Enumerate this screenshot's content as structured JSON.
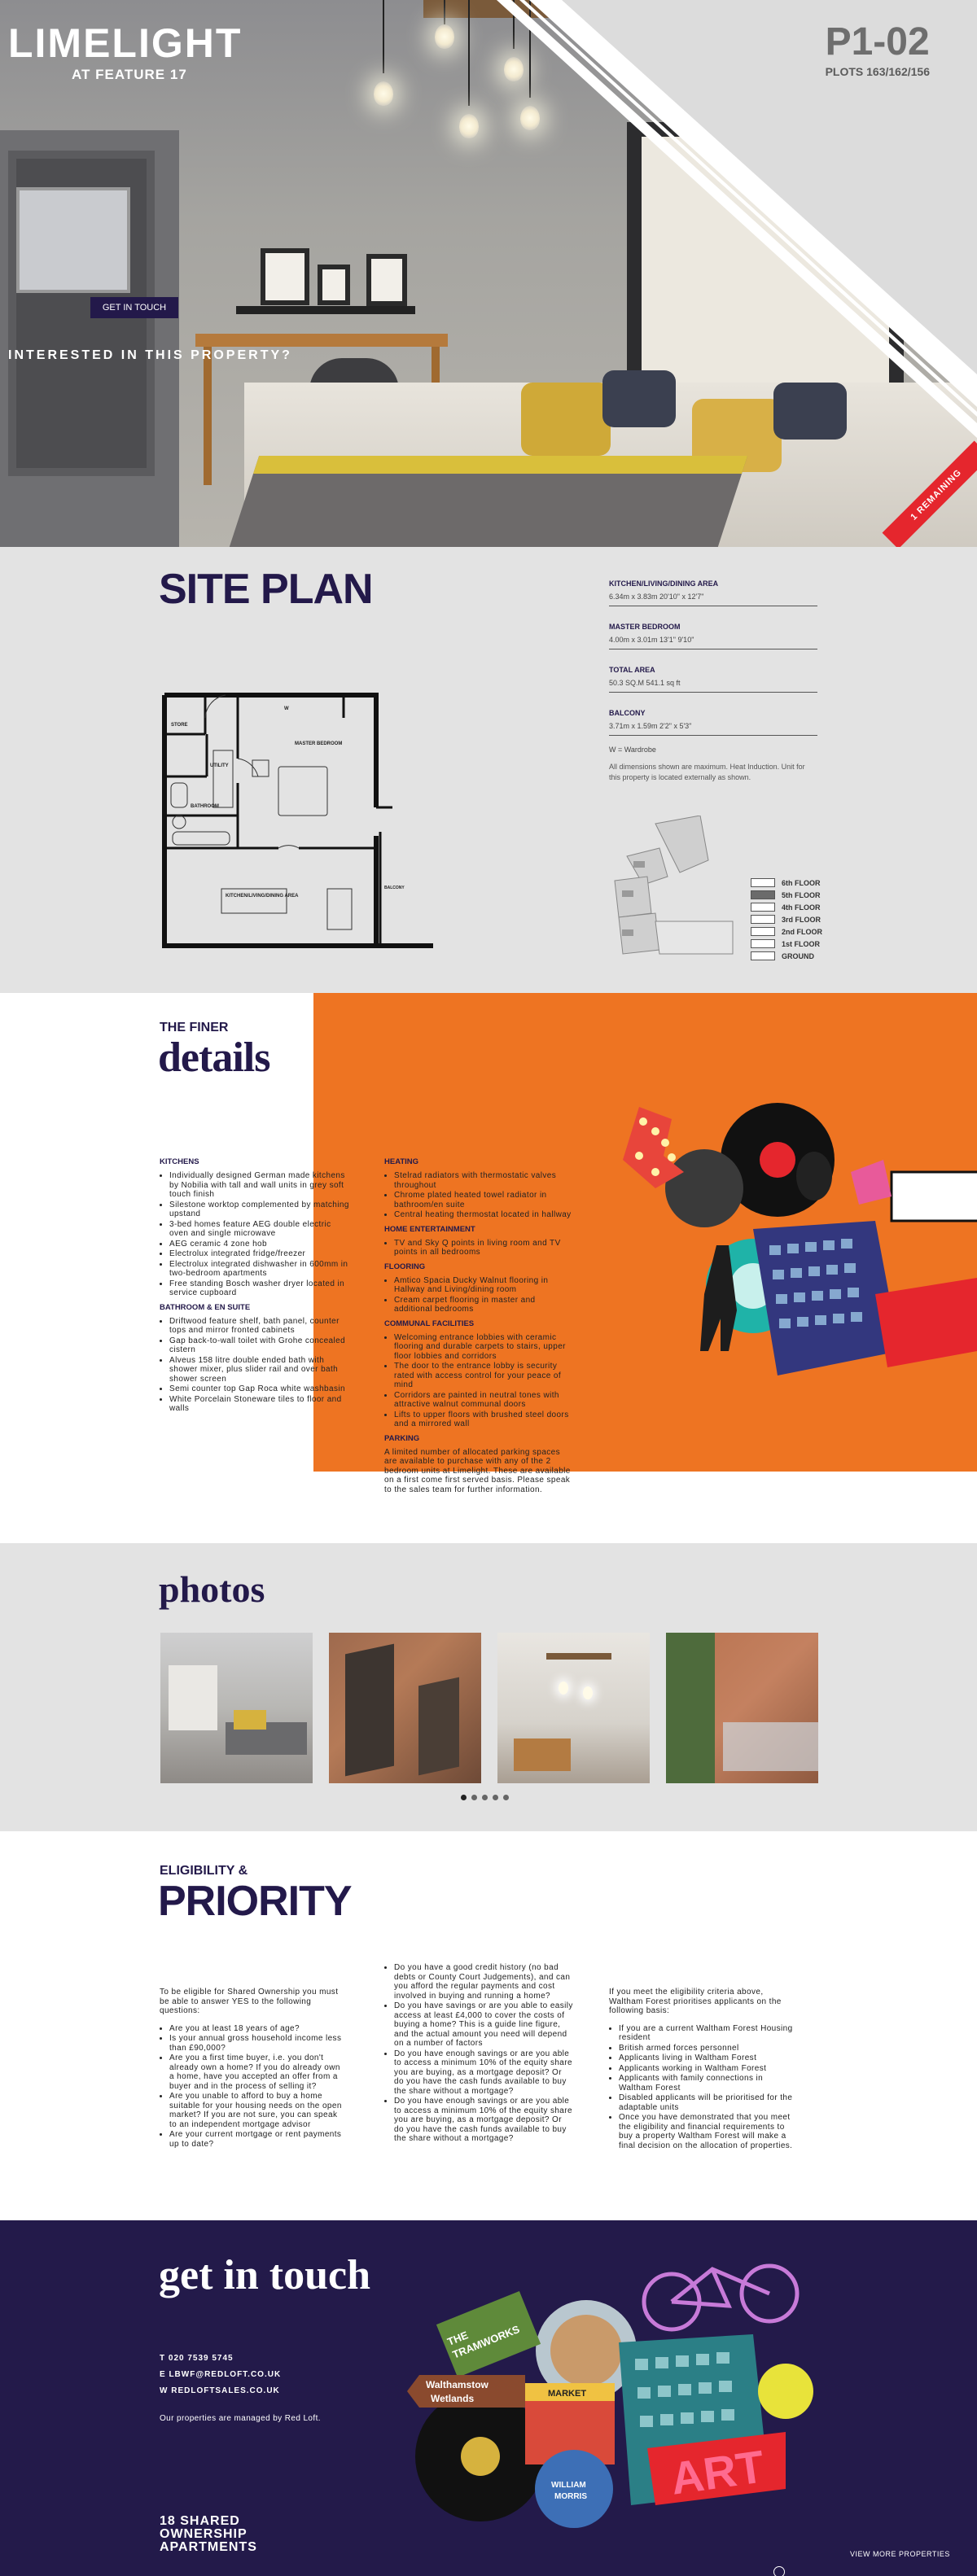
{
  "hero": {
    "logo_main": "LIMELIGHT",
    "logo_sub": "AT FEATURE 17",
    "plot_title": "P1-02",
    "plot_sub": "PLOTS 163/162/156",
    "cta_button": "GET IN TOUCH",
    "cta_text": "INTERESTED IN THIS PROPERTY?",
    "badge": "1 REMAINING"
  },
  "site_plan": {
    "title": "SITE PLAN",
    "specs": [
      {
        "label": "KITCHEN/LIVING/DINING AREA",
        "value": "6.34m x 3.83m 20'10\" x 12'7\""
      },
      {
        "label": "MASTER BEDROOM",
        "value": "4.00m x 3.01m 13'1\" 9'10\""
      },
      {
        "label": "TOTAL AREA",
        "value": "50.3 SQ.M 541.1 sq ft"
      },
      {
        "label": "BALCONY",
        "value": "3.71m x 1.59m 2'2\" x 5'3\""
      }
    ],
    "wardrobe_note": "W = Wardrobe",
    "dimensions_note": "All dimensions shown are maximum. Heat Induction. Unit for this property is located externally as shown.",
    "rooms": {
      "store": "STORE",
      "utility": "UTILITY",
      "bathroom": "BATHROOM",
      "master_bedroom": "MASTER BEDROOM",
      "kitchen": "KITCHEN/LIVING/DINING AREA",
      "balcony": "BALCONY",
      "wardrobe": "W"
    },
    "floors": [
      {
        "label": "6th FLOOR",
        "color": "#ffffff"
      },
      {
        "label": "5th FLOOR",
        "color": "#6b6b6b"
      },
      {
        "label": "4th FLOOR",
        "color": "#ffffff"
      },
      {
        "label": "3rd FLOOR",
        "color": "#ffffff"
      },
      {
        "label": "2nd FLOOR",
        "color": "#ffffff"
      },
      {
        "label": "1st FLOOR",
        "color": "#ffffff"
      },
      {
        "label": "GROUND",
        "color": "#ffffff"
      }
    ]
  },
  "details": {
    "kicker": "THE FINER",
    "title": "details",
    "kitchens_heading": "KITCHENS",
    "kitchens": [
      "Individually designed German made kitchens by Nobilia with tall and wall units in grey soft touch finish",
      "Silestone worktop complemented by matching upstand",
      "3-bed homes feature AEG double electric oven and single microwave",
      "AEG ceramic 4 zone hob",
      "Electrolux integrated fridge/freezer",
      "Electrolux integrated dishwasher in 600mm in two-bedroom apartments",
      "Free standing Bosch washer dryer located in service cupboard"
    ],
    "bathroom_heading": "BATHROOM & EN SUITE",
    "bathroom": [
      "Driftwood feature shelf, bath panel, counter tops and mirror fronted cabinets",
      "Gap back-to-wall toilet with Grohe concealed cistern",
      "Alveus 158 litre double ended bath with shower mixer, plus slider rail and over bath shower screen",
      "Semi counter top Gap Roca white washbasin",
      "White Porcelain Stoneware tiles to floor and walls"
    ],
    "heating_heading": "HEATING",
    "heating": [
      "Stelrad radiators with thermostatic valves throughout",
      "Chrome plated heated towel radiator in bathroom/en suite",
      "Central heating thermostat located in hallway"
    ],
    "home_ent_heading": "HOME ENTERTAINMENT",
    "home_ent": [
      "TV and Sky Q points in living room and TV points in all bedrooms"
    ],
    "flooring_heading": "FLOORING",
    "flooring": [
      "Amtico Spacia Ducky Walnut flooring in Hallway and Living/dining room",
      "Cream carpet flooring in master and additional bedrooms"
    ],
    "communal_heading": "COMMUNAL FACILITIES",
    "communal": [
      "Welcoming entrance lobbies with ceramic flooring and durable carpets to stairs, upper floor lobbies and corridors",
      "The door to the entrance lobby is security rated with access control for your peace of mind",
      "Corridors are painted in neutral tones with attractive walnut communal doors",
      "Lifts to upper floors with brushed steel doors and a mirrored wall"
    ],
    "parking_heading": "PARKING",
    "parking": "A limited number of allocated parking spaces are available to purchase with any of the 2 bedroom units at Limelight. These are available on a first come first served basis. Please speak to the sales team for further information.",
    "collage_colors": {
      "orange": "#ee7422",
      "navy": "#23194a",
      "red": "#e5262d",
      "pink": "#e85a9a"
    }
  },
  "photos": {
    "title": "photos",
    "slides": 5,
    "active_slide": 1
  },
  "eligibility": {
    "kicker": "ELIGIBILITY &",
    "title": "PRIORITY",
    "intro": "To be eligible for Shared Ownership you must be able to answer YES to the following questions:",
    "col1": [
      "Are you at least 18 years of age?",
      "Is your annual gross household income less than £90,000?",
      "Are you a first time buyer, i.e. you don't already own a home? If you do already own a home, have you accepted an offer from a buyer and in the process of selling it?",
      "Are you unable to afford to buy a home suitable for your housing needs on the open market? If you are not sure, you can speak to an independent mortgage advisor",
      "Are your current mortgage or rent payments up to date?"
    ],
    "col2": [
      "Do you have a good credit history (no bad debts or County Court Judgements), and can you afford the regular payments and cost involved in buying and running a home?",
      "Do you have savings or are you able to easily access at least £4,000 to cover the costs of buying a home? This is a guide line figure, and the actual amount you need will depend on a number of factors",
      "Do you have enough savings or are you able to access a minimum 10% of the equity share you are buying, as a mortgage deposit? Or do you have the cash funds available to buy the share without a mortgage?",
      "Do you have enough savings or are you able to access a minimum 10% of the equity share you are buying, as a mortgage deposit? Or do you have the cash funds available to buy the share without a mortgage?"
    ],
    "col3_intro": "If you meet the eligibility criteria above, Waltham Forest prioritises applicants on the following basis:",
    "col3": [
      "If you are a current Waltham Forest Housing resident",
      "British armed forces personnel",
      "Applicants living in Waltham Forest",
      "Applicants working in Waltham Forest",
      "Applicants with family connections in Waltham Forest",
      "Disabled applicants will be prioritised for the adaptable units",
      "Once you have demonstrated that you meet the eligibility and financial requirements to buy a property Waltham Forest will make a final decision on the allocation of properties."
    ]
  },
  "contact": {
    "title": "get in touch",
    "phone": "T 020 7539 5745",
    "email": "E LBWF@REDLOFT.CO.UK",
    "web": "W REDLOFTSALES.CO.UK",
    "managed": "Our properties are managed by Red Loft.",
    "apartments_line1": "18 SHARED",
    "apartments_line2": "OWNERSHIP",
    "apartments_line3": "APARTMENTS",
    "view_more": "VIEW MORE PROPERTIES",
    "collage_signs": {
      "tramworks_1": "THE",
      "tramworks_2": "TRAMWORKS",
      "walthamstow_1": "Walthamstow",
      "walthamstow_2": "Wetlands",
      "market": "MARKET",
      "morris_1": "WILLIAM",
      "morris_2": "MORRIS",
      "art": "ART"
    }
  }
}
